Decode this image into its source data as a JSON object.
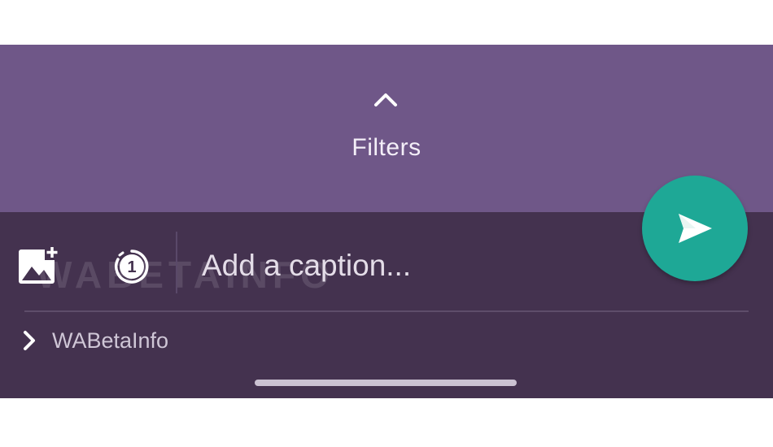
{
  "filters": {
    "icon": "chevron-up-icon",
    "label": "Filters"
  },
  "composer": {
    "add_media_icon": "image-add-icon",
    "view_once_icon": "view-once-icon",
    "view_once_count": "1",
    "caption_placeholder": "Add a caption...",
    "watermark": "WABETAINFO"
  },
  "send": {
    "icon": "send-icon",
    "color": "#1ea896"
  },
  "recipient": {
    "icon": "chevron-right-icon",
    "label": "WABetaInfo"
  },
  "colors": {
    "filters_panel": "#6f5788",
    "bottom_panel": "#44324f",
    "accent": "#1ea896"
  }
}
